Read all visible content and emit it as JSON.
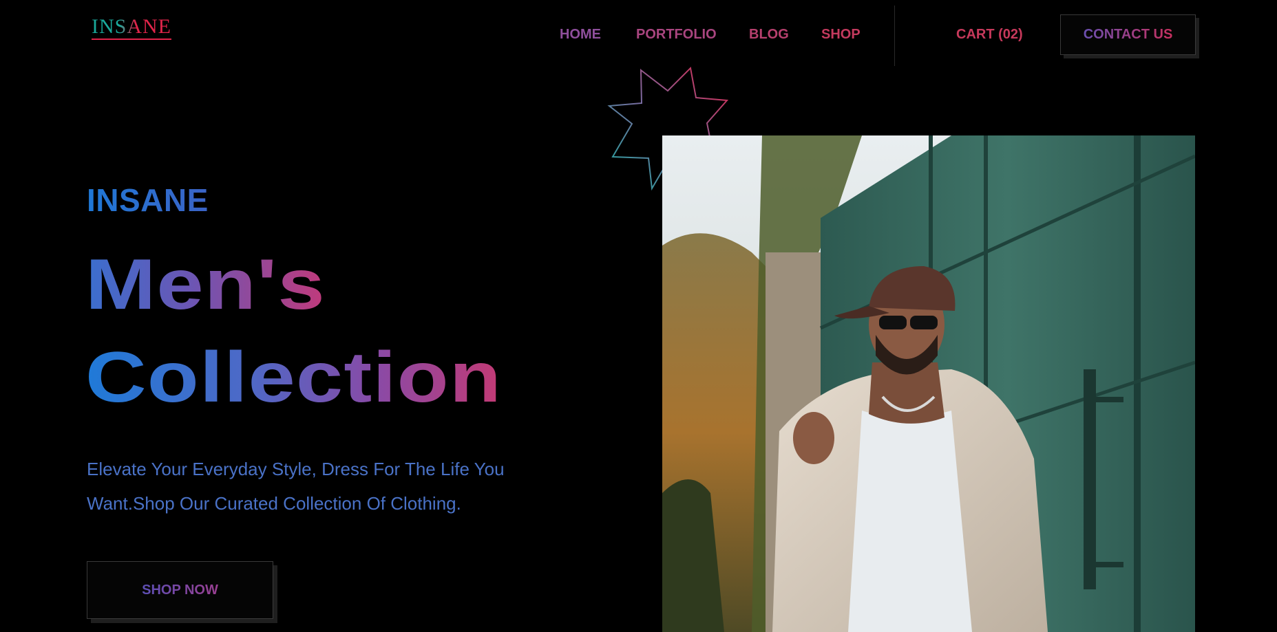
{
  "header": {
    "logo": "INSANE",
    "nav": [
      {
        "label": "HOME",
        "color": "#8f4f9c"
      },
      {
        "label": "PORTFOLIO",
        "color": "#a9457f"
      },
      {
        "label": "BLOG",
        "color": "#b7406e"
      },
      {
        "label": "SHOP",
        "color": "#c43a5e"
      }
    ],
    "cart_label": "CART (02)",
    "cart_color": "#c7395b",
    "contact_label": "CONTACT US"
  },
  "hero": {
    "brand": "INSANE",
    "title_line1": "Men's",
    "title_line2": "Collection",
    "subtitle": "Elevate Your Everyday Style, Dress For The Life You Want.Shop Our Curated Collection Of Clothing.",
    "cta_label": "SHOP NOW",
    "photo_icon": "model-photo"
  },
  "colors": {
    "background": "#000000",
    "accent_blue": "#1f7ad8",
    "accent_pink": "#c8305f",
    "accent_teal": "#1aa99b"
  }
}
